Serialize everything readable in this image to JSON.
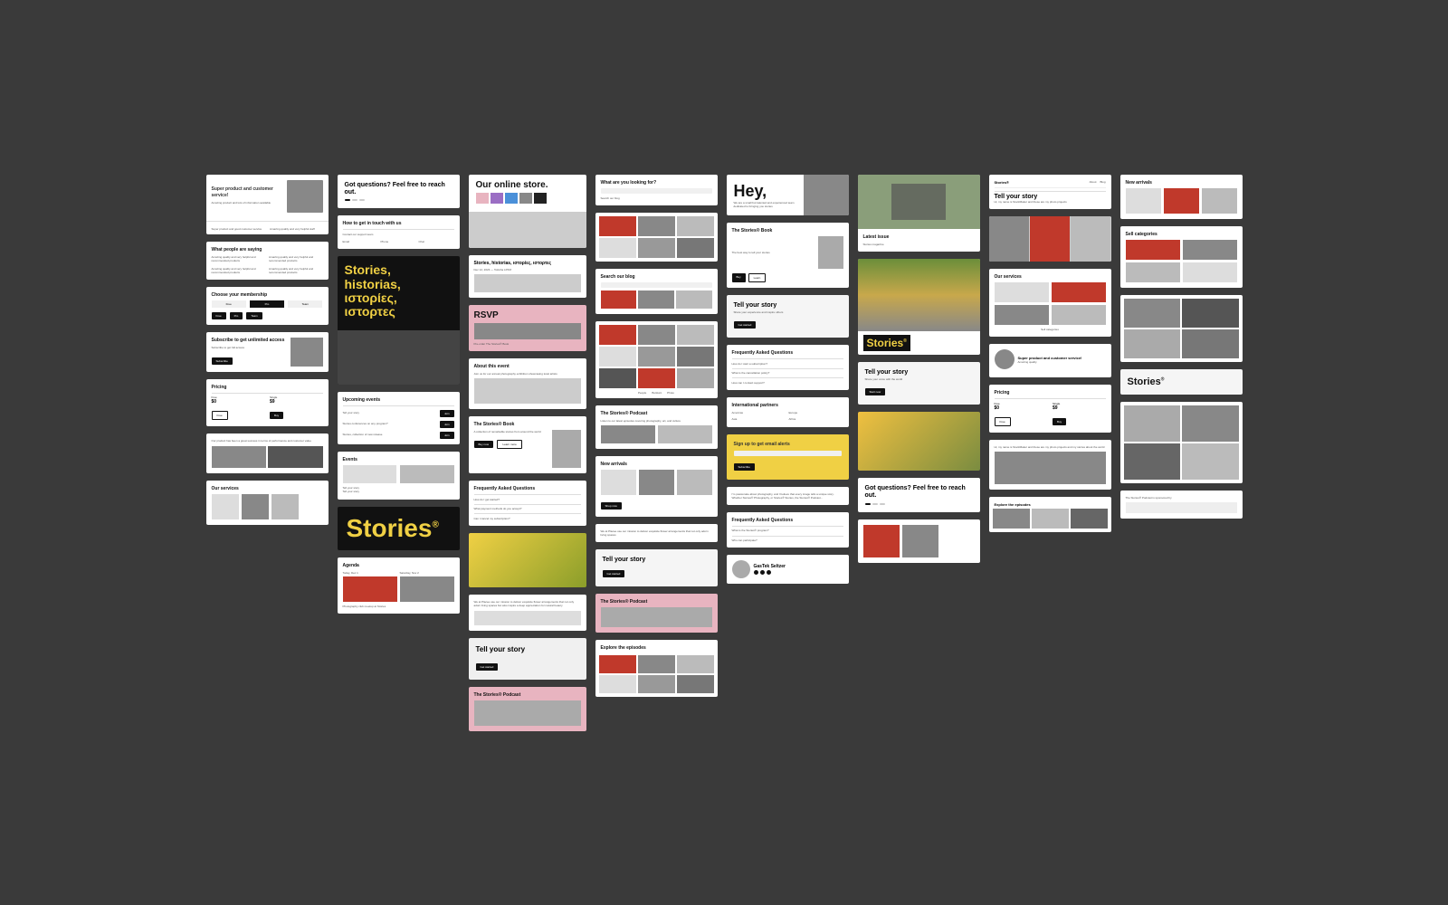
{
  "background": "#3a3a3a",
  "columns": [
    {
      "id": "col1",
      "cards": [
        {
          "id": "c1-1",
          "type": "testimonial-hero"
        },
        {
          "id": "c1-2",
          "type": "testimonials-list",
          "title": "What people are saying"
        },
        {
          "id": "c1-3",
          "type": "membership",
          "title": "Choose your membership"
        },
        {
          "id": "c1-4",
          "type": "subscribe",
          "title": "Subscribe to get unlimited access"
        },
        {
          "id": "c1-5",
          "type": "pricing",
          "title": "Pricing"
        },
        {
          "id": "c1-6",
          "type": "testimonials-photos"
        },
        {
          "id": "c1-7",
          "type": "services",
          "title": "Our services"
        }
      ]
    },
    {
      "id": "col2",
      "cards": [
        {
          "id": "c2-1",
          "type": "contact",
          "title": "Got questions? Feel free to reach out."
        },
        {
          "id": "c2-2",
          "type": "contact-how",
          "title": "How to get in touch with us"
        },
        {
          "id": "c2-3",
          "type": "stories-dark",
          "title": "Stories, historias, ιστορίες, ιστορτες"
        },
        {
          "id": "c2-4",
          "type": "upcoming",
          "title": "Upcoming events"
        },
        {
          "id": "c2-5",
          "type": "events-list",
          "title": "Events"
        },
        {
          "id": "c2-6",
          "type": "stories-yellow-big"
        },
        {
          "id": "c2-7",
          "type": "agenda",
          "title": "Agenda"
        }
      ]
    },
    {
      "id": "col3",
      "cards": [
        {
          "id": "c3-1",
          "type": "store-hero",
          "title": "Our online store."
        },
        {
          "id": "c3-2",
          "type": "stories-text-card",
          "title": "Stories, historias, ιστορίες, ιστορτες"
        },
        {
          "id": "c3-3",
          "type": "rsvp-card"
        },
        {
          "id": "c3-4",
          "type": "podcast-promo"
        },
        {
          "id": "c3-5",
          "type": "book-promo",
          "title": "The Stories® Book"
        },
        {
          "id": "c3-6",
          "type": "faq-card",
          "title": "Frequently Asked Questions"
        },
        {
          "id": "c3-7",
          "type": "yellow-flower"
        },
        {
          "id": "c3-8",
          "type": "about-us"
        },
        {
          "id": "c3-9",
          "type": "tell-story",
          "title": "Tell your story"
        },
        {
          "id": "c3-10",
          "type": "flowers-grid"
        },
        {
          "id": "c3-11",
          "type": "pink-podcast",
          "title": "The Stories® Podcast"
        }
      ]
    },
    {
      "id": "col4",
      "cards": [
        {
          "id": "c4-1",
          "type": "search-blog",
          "title": "What are you looking for?"
        },
        {
          "id": "c4-2",
          "type": "blog-grid"
        },
        {
          "id": "c4-3",
          "type": "search-blog2",
          "title": "Search our blog"
        },
        {
          "id": "c4-4",
          "type": "blog-photos"
        },
        {
          "id": "c4-5",
          "type": "podcast-card",
          "title": "The Stories® Podcast"
        },
        {
          "id": "c4-6",
          "type": "new-arrivals",
          "title": "New arrivals"
        },
        {
          "id": "c4-7",
          "type": "about-placee"
        },
        {
          "id": "c4-8",
          "type": "tell-story2",
          "title": "Tell your story"
        },
        {
          "id": "c4-9",
          "type": "pink-podcast2",
          "title": "The Stories® Podcast"
        },
        {
          "id": "c4-10",
          "type": "explore-episodes",
          "title": "Explore the episodes"
        }
      ]
    },
    {
      "id": "col5",
      "cards": [
        {
          "id": "c5-1",
          "type": "hey-card",
          "title": "Hey,"
        },
        {
          "id": "c5-2",
          "type": "stories-book",
          "title": "The Stories® Book"
        },
        {
          "id": "c5-3",
          "type": "tell-story3",
          "title": "Tell your story"
        },
        {
          "id": "c5-4",
          "type": "faq2",
          "title": "Frequently Asked Questions"
        },
        {
          "id": "c5-5",
          "type": "intl-partners",
          "title": "International partners"
        },
        {
          "id": "c5-6",
          "type": "sign-up"
        },
        {
          "id": "c5-7",
          "type": "about-content"
        },
        {
          "id": "c5-8",
          "type": "contact-faq"
        },
        {
          "id": "c5-9",
          "type": "person-card",
          "title": "GasTek Seltzer"
        }
      ]
    },
    {
      "id": "col6",
      "cards": [
        {
          "id": "c6-1",
          "type": "green-hero"
        },
        {
          "id": "c6-2",
          "type": "field-photo"
        },
        {
          "id": "c6-3",
          "type": "tell-story4",
          "title": "Tell your story"
        },
        {
          "id": "c6-4",
          "type": "lemon-photo"
        },
        {
          "id": "c6-5",
          "type": "contact-footer",
          "title": "Got questions? Feel free to reach out."
        },
        {
          "id": "c6-6",
          "type": "flower-promo"
        }
      ]
    },
    {
      "id": "col7",
      "cards": [
        {
          "id": "c7-1",
          "type": "tell-story-header",
          "title": "Tell your story"
        },
        {
          "id": "c7-2",
          "type": "flowers-card"
        },
        {
          "id": "c7-3",
          "type": "our-services",
          "title": "Our services"
        },
        {
          "id": "c7-4",
          "type": "product-card"
        },
        {
          "id": "c7-5",
          "type": "pricing-card",
          "title": "Pricing"
        },
        {
          "id": "c7-6",
          "type": "bio-card"
        },
        {
          "id": "c7-7",
          "type": "explore-episodes2",
          "title": "Explore the episodes"
        }
      ]
    },
    {
      "id": "col8",
      "cards": [
        {
          "id": "c8-1",
          "type": "new-arrivals2",
          "title": "New arrivals"
        },
        {
          "id": "c8-2",
          "type": "categories"
        },
        {
          "id": "c8-3",
          "type": "photo-grid-large"
        },
        {
          "id": "c8-4",
          "type": "stories-badge",
          "title": "Stories®"
        },
        {
          "id": "c8-5",
          "type": "person-photos"
        },
        {
          "id": "c8-6",
          "type": "podcast-footer",
          "title": "The Stories® Podcast is sponsored by"
        }
      ]
    }
  ]
}
